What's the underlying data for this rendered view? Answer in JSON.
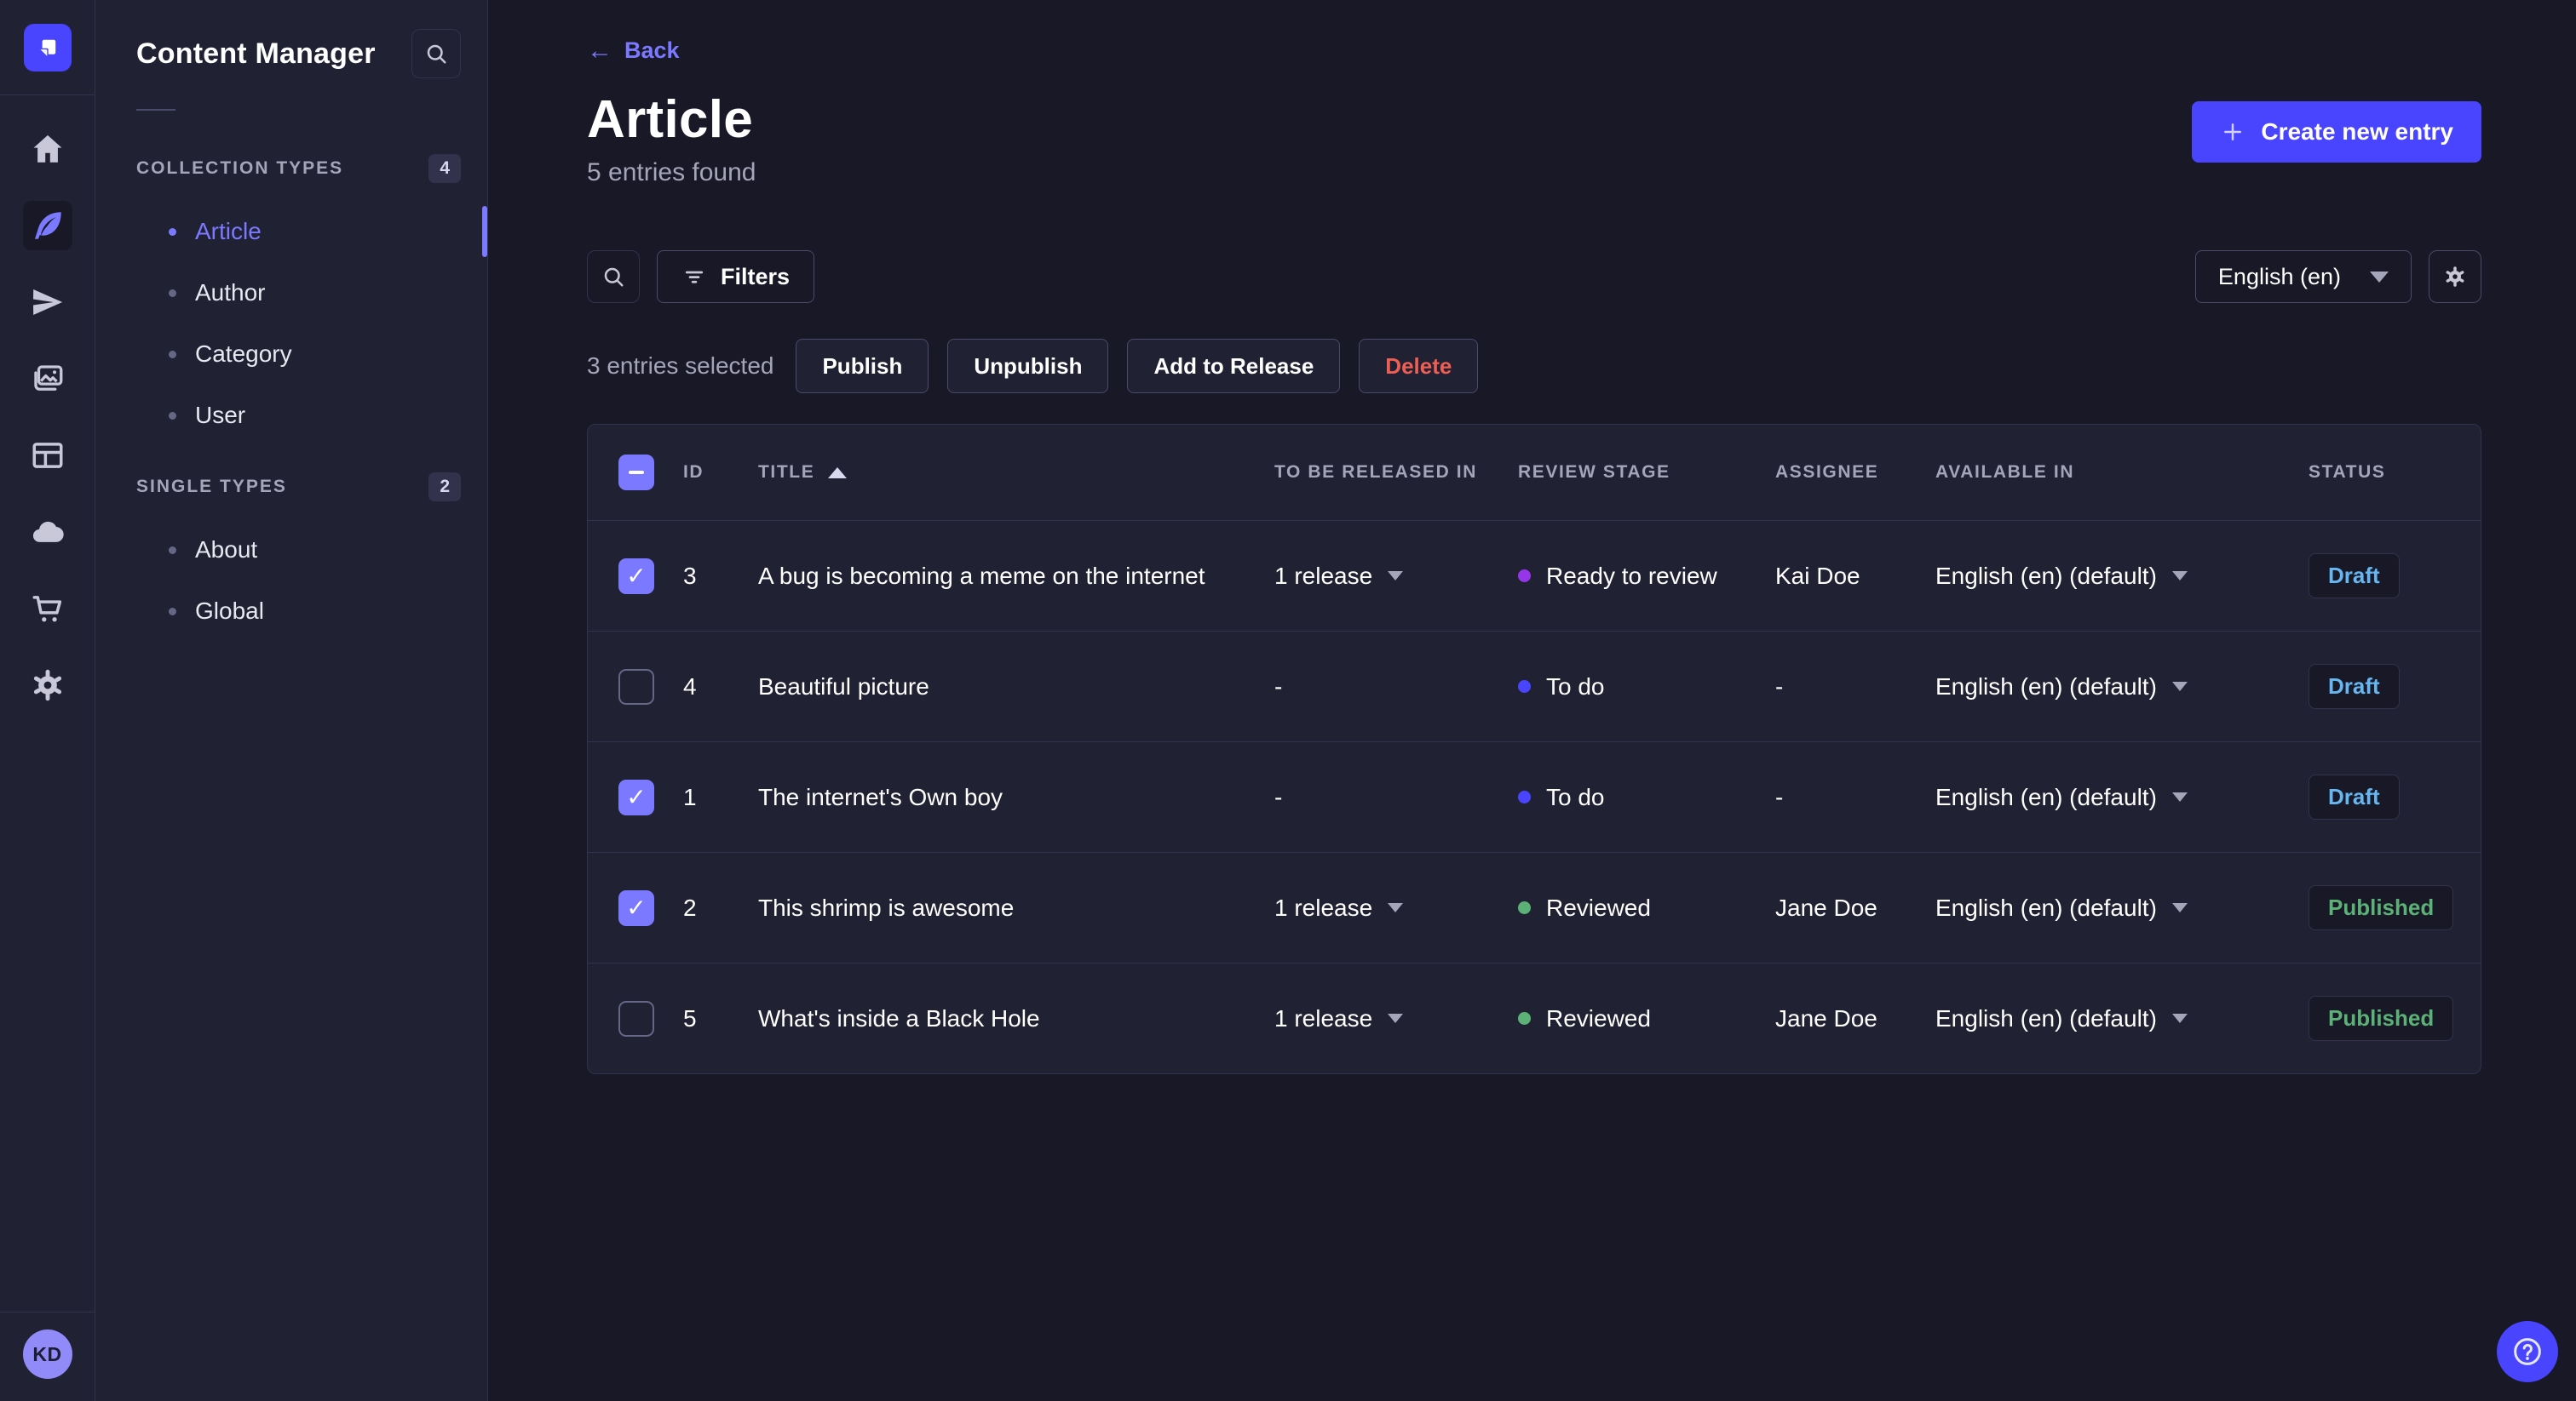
{
  "rail": {
    "items": [
      {
        "name": "home",
        "active": false
      },
      {
        "name": "content-manager",
        "active": true
      },
      {
        "name": "transfer",
        "active": false
      },
      {
        "name": "media-library",
        "active": false
      },
      {
        "name": "content-type-builder",
        "active": false
      },
      {
        "name": "cloud",
        "active": false
      },
      {
        "name": "marketplace",
        "active": false
      },
      {
        "name": "settings",
        "active": false
      }
    ],
    "avatar_initials": "KD"
  },
  "sidebar": {
    "title": "Content Manager",
    "sections": [
      {
        "label": "COLLECTION TYPES",
        "badge": "4",
        "items": [
          {
            "label": "Article",
            "active": true
          },
          {
            "label": "Author",
            "active": false
          },
          {
            "label": "Category",
            "active": false
          },
          {
            "label": "User",
            "active": false
          }
        ]
      },
      {
        "label": "SINGLE TYPES",
        "badge": "2",
        "items": [
          {
            "label": "About",
            "active": false
          },
          {
            "label": "Global",
            "active": false
          }
        ]
      }
    ]
  },
  "header": {
    "back_label": "Back",
    "title": "Article",
    "subtitle": "5 entries found",
    "create_button": "Create new entry"
  },
  "toolbar": {
    "filters_label": "Filters",
    "locale_value": "English (en)"
  },
  "selection": {
    "text": "3 entries selected",
    "publish_label": "Publish",
    "unpublish_label": "Unpublish",
    "add_to_release_label": "Add to Release",
    "delete_label": "Delete"
  },
  "table": {
    "header_checkbox": "mixed",
    "columns": [
      "ID",
      "TITLE",
      "TO BE RELEASED IN",
      "REVIEW STAGE",
      "ASSIGNEE",
      "AVAILABLE IN",
      "STATUS"
    ],
    "sort": {
      "column": "TITLE",
      "direction": "asc"
    },
    "rows": [
      {
        "checked": true,
        "id": "3",
        "title": "A bug is becoming a meme on the internet",
        "release": "1 release",
        "stage": "Ready to review",
        "stage_color": "#9736e8",
        "assignee": "Kai Doe",
        "available": "English (en) (default)",
        "status": "Draft"
      },
      {
        "checked": false,
        "id": "4",
        "title": "Beautiful picture",
        "release": "-",
        "stage": "To do",
        "stage_color": "#4945ff",
        "assignee": "-",
        "available": "English (en) (default)",
        "status": "Draft"
      },
      {
        "checked": true,
        "id": "1",
        "title": "The internet's Own boy",
        "release": "-",
        "stage": "To do",
        "stage_color": "#4945ff",
        "assignee": "-",
        "available": "English (en) (default)",
        "status": "Draft"
      },
      {
        "checked": true,
        "id": "2",
        "title": "This shrimp is awesome",
        "release": "1 release",
        "stage": "Reviewed",
        "stage_color": "#5cb176",
        "assignee": "Jane Doe",
        "available": "English (en) (default)",
        "status": "Published"
      },
      {
        "checked": false,
        "id": "5",
        "title": "What's inside a Black Hole",
        "release": "1 release",
        "stage": "Reviewed",
        "stage_color": "#5cb176",
        "assignee": "Jane Doe",
        "available": "English (en) (default)",
        "status": "Published"
      }
    ]
  },
  "colors": {
    "primary": "#4945ff",
    "primary_light": "#7b79ff",
    "draft": "#66b7f1",
    "published": "#5cb176",
    "danger": "#ee5e52"
  }
}
